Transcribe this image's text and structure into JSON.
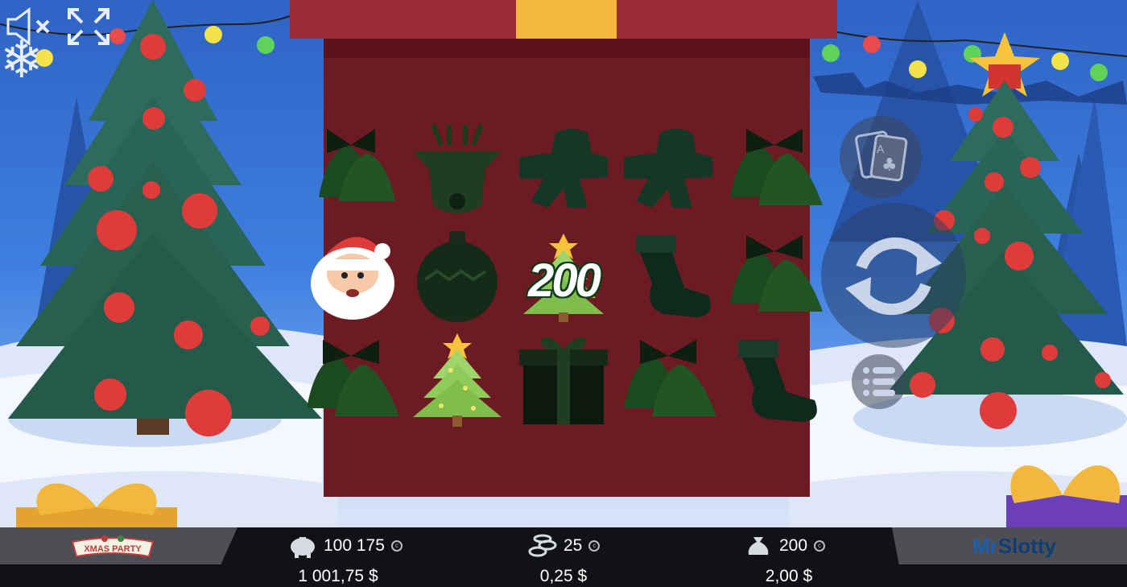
{
  "game": {
    "logo_text": "XMAS PARTY",
    "brand_mr": "Mr",
    "brand_slotty": "Slotty"
  },
  "top_controls": {
    "mute_icon": "speaker-muted-icon",
    "fullscreen_icon": "fullscreen-icon"
  },
  "reels": {
    "grid": [
      [
        "bells",
        "reindeer",
        "gingerbread",
        "gingerbread",
        "bells"
      ],
      [
        "santa",
        "ornament",
        "tree",
        "stocking",
        "bells"
      ],
      [
        "bells",
        "tree",
        "gift",
        "bells",
        "stocking"
      ]
    ],
    "win_amount": "200"
  },
  "side_controls": {
    "gamble_icon": "cards-icon",
    "spin_icon": "spin-icon",
    "menu_icon": "menu-icon"
  },
  "bottom_bar": {
    "balance_credits": "100 175",
    "balance_money": "1 001,75 $",
    "bet_credits": "25",
    "bet_money": "0,25 $",
    "win_credits": "200",
    "win_money": "2,00 $",
    "balance_icon": "piggy-bank-icon",
    "bet_icon": "chips-icon",
    "win_icon": "money-bag-icon",
    "coin_icon": "coin-icon"
  },
  "colors": {
    "box_red": "#6c1b22",
    "lid_red": "#9b2a37",
    "ribbon_gold": "#f2b73c",
    "bar_dark": "#101216"
  }
}
